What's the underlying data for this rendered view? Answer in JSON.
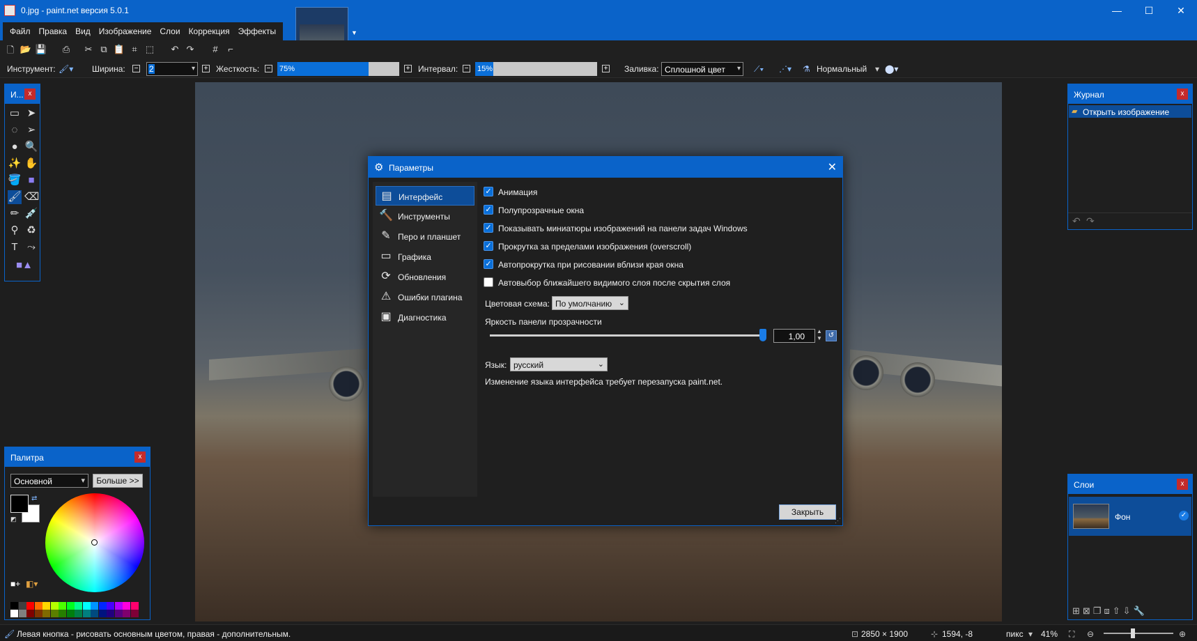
{
  "window": {
    "title": "0.jpg - paint.net версия 5.0.1",
    "minimize": "—",
    "maximize": "☐",
    "close": "✕"
  },
  "menu": [
    "Файл",
    "Правка",
    "Вид",
    "Изображение",
    "Слои",
    "Коррекция",
    "Эффекты"
  ],
  "toolbar": {
    "tool_label": "Инструмент:",
    "width_label": "Ширина:",
    "width_value": "2",
    "hardness_label": "Жесткость:",
    "hardness_value": "75%",
    "hardness_percent": 75,
    "interval_label": "Интервал:",
    "interval_value": "15%",
    "interval_percent": 15,
    "fill_label": "Заливка:",
    "fill_value": "Сплошной цвет",
    "blend_value": "Нормальный"
  },
  "tools_panel": {
    "title": "И..."
  },
  "history_panel": {
    "title": "Журнал",
    "items": [
      "Открыть изображение"
    ]
  },
  "layers_panel": {
    "title": "Слои",
    "layers": [
      {
        "name": "Фон",
        "visible": true
      }
    ]
  },
  "palette_panel": {
    "title": "Палитра",
    "palette_select": "Основной",
    "more_button": "Больше >>",
    "primary_color": "#000000",
    "secondary_color": "#ffffff",
    "swatches_top": [
      "#000000",
      "#404040",
      "#ff0000",
      "#ff6a00",
      "#ffd800",
      "#b6ff00",
      "#4cff00",
      "#00ff21",
      "#00ff90",
      "#00ffff",
      "#0094ff",
      "#0026ff",
      "#4800ff",
      "#b200ff",
      "#ff00dc",
      "#ff006e"
    ],
    "swatches_bottom": [
      "#ffffff",
      "#808080",
      "#7f0000",
      "#7f3300",
      "#7f6a00",
      "#5b7f00",
      "#267f00",
      "#007f0e",
      "#007f46",
      "#007f7f",
      "#004a7f",
      "#00137f",
      "#21007f",
      "#57007f",
      "#7f006e",
      "#7f0037"
    ]
  },
  "dialog": {
    "title": "Параметры",
    "nav": [
      {
        "label": "Интерфейс",
        "icon": "window-icon",
        "glyph": "▤",
        "selected": true
      },
      {
        "label": "Инструменты",
        "icon": "hammer-icon",
        "glyph": "🔨",
        "selected": false
      },
      {
        "label": "Перо и планшет",
        "icon": "tablet-pen-icon",
        "glyph": "✎",
        "selected": false
      },
      {
        "label": "Графика",
        "icon": "gpu-icon",
        "glyph": "▭",
        "selected": false
      },
      {
        "label": "Обновления",
        "icon": "refresh-icon",
        "glyph": "⟳",
        "selected": false
      },
      {
        "label": "Ошибки плагина",
        "icon": "plugin-warning-icon",
        "glyph": "⚠",
        "selected": false
      },
      {
        "label": "Диагностика",
        "icon": "diagnostics-icon",
        "glyph": "▣",
        "selected": false
      }
    ],
    "options": [
      {
        "label": "Анимация",
        "checked": true
      },
      {
        "label": "Полупрозрачные окна",
        "checked": true
      },
      {
        "label": "Показывать миниатюры изображений на панели задач Windows",
        "checked": true
      },
      {
        "label": "Прокрутка за пределами изображения (overscroll)",
        "checked": true
      },
      {
        "label": "Автопрокрутка при рисовании вблизи края окна",
        "checked": true
      },
      {
        "label": "Автовыбор ближайшего видимого слоя после скрытия слоя",
        "checked": false
      }
    ],
    "color_scheme_label": "Цветовая схема:",
    "color_scheme_value": "По умолчанию",
    "brightness_label": "Яркость панели прозрачности",
    "brightness_value": "1,00",
    "language_label": "Язык:",
    "language_value": "русский",
    "language_note": "Изменение языка интерфейса требует перезапуска paint.net.",
    "close_button": "Закрыть"
  },
  "status": {
    "hint": "Левая кнопка - рисовать основным цветом, правая - дополнительным.",
    "image_size": "2850 × 1900",
    "cursor_pos": "1594, -8",
    "units": "пикс",
    "zoom": "41%"
  }
}
